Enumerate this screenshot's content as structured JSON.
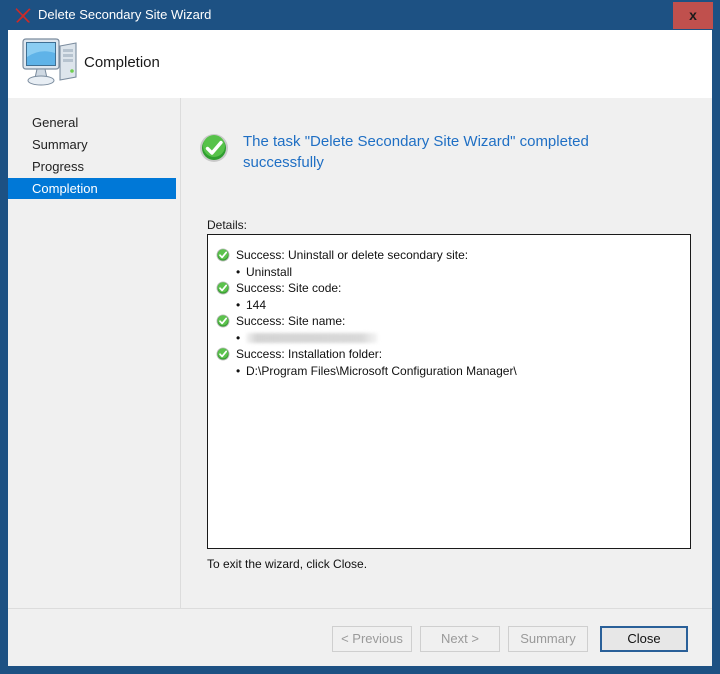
{
  "window": {
    "title": "Delete Secondary Site Wizard",
    "title_icon": "red-x-icon",
    "close_label": "x"
  },
  "header": {
    "title": "Completion",
    "icon": "computer-icon"
  },
  "sidebar": {
    "items": [
      {
        "label": "General",
        "selected": false
      },
      {
        "label": "Summary",
        "selected": false
      },
      {
        "label": "Progress",
        "selected": false
      },
      {
        "label": "Completion",
        "selected": true
      }
    ]
  },
  "content": {
    "result_icon": "green-check-circle-icon",
    "result_text": "The task \"Delete Secondary Site Wizard\" completed successfully",
    "details_label": "Details:",
    "details": [
      {
        "icon": "green-check-icon",
        "heading": "Success: Uninstall or delete secondary site:",
        "value": "Uninstall",
        "redacted": false
      },
      {
        "icon": "green-check-icon",
        "heading": "Success: Site code:",
        "value": "144",
        "redacted": false
      },
      {
        "icon": "green-check-icon",
        "heading": "Success: Site name:",
        "value": "",
        "redacted": true
      },
      {
        "icon": "green-check-icon",
        "heading": "Success: Installation folder:",
        "value": "D:\\Program Files\\Microsoft Configuration Manager\\",
        "redacted": false
      }
    ],
    "exit_note": "To exit the wizard, click Close."
  },
  "footer": {
    "previous_label": "< Previous",
    "next_label": "Next >",
    "summary_label": "Summary",
    "close_label": "Close"
  },
  "colors": {
    "titlebar": "#1d5183",
    "close_button": "#c0504d",
    "selection": "#0078d7",
    "link_text": "#1f6fc4",
    "success": "#32a032"
  }
}
